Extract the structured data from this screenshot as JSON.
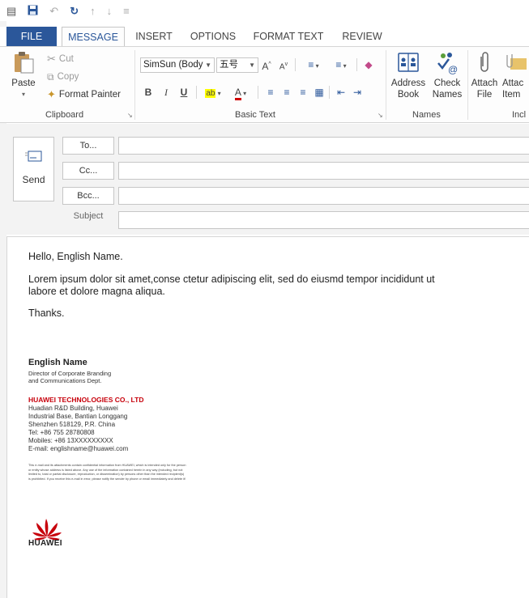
{
  "ribbon_tabs": {
    "file": "FILE",
    "message": "MESSAGE",
    "insert": "INSERT",
    "options": "OPTIONS",
    "format_text": "FORMAT TEXT",
    "review": "REVIEW"
  },
  "clipboard": {
    "paste": "Paste",
    "cut": "Cut",
    "copy": "Copy",
    "format_painter": "Format Painter",
    "group_label": "Clipboard"
  },
  "basic_text": {
    "font_name": "SimSun (Body",
    "font_size": "五号",
    "bold": "B",
    "italic": "I",
    "underline": "U",
    "grow_font": "A",
    "shrink_font": "A",
    "font_color": "A",
    "group_label": "Basic Text"
  },
  "names": {
    "address_book_line1": "Address",
    "address_book_line2": "Book",
    "check_names_line1": "Check",
    "check_names_line2": "Names",
    "group_label": "Names"
  },
  "include": {
    "attach_file_line1": "Attach",
    "attach_file_line2": "File",
    "attach_item_line1": "Attac",
    "attach_item_line2": "Item",
    "group_label": "Incl"
  },
  "envelope": {
    "send": "Send",
    "to": "To...",
    "cc": "Cc...",
    "bcc": "Bcc...",
    "subject": "Subject",
    "to_value": "",
    "cc_value": "",
    "bcc_value": "",
    "subject_value": ""
  },
  "body": {
    "greeting": "Hello, English Name.",
    "paragraph_line1": "Lorem ipsum dolor sit amet,conse ctetur adipiscing elit, sed do eiusmd tempor incididunt ut",
    "paragraph_line2": "labore et dolore magna aliqua.",
    "closing": "Thanks."
  },
  "signature": {
    "name": "English Name",
    "title_line1": "Director of Corporate Branding",
    "title_line2": "and Communications Dept.",
    "company": "HUAWEI TECHNOLOGIES CO., LTD",
    "address_line1": "Huadian R&D Building, Huawei",
    "address_line2": "Industrial Base, Bantian Longgang",
    "address_line3": "Shenzhen 518129, P.R. China",
    "tel": "Tel: +86 755 28780808",
    "mobile": "Mobiles: +86 13XXXXXXXXX",
    "email": "E-mail: englishname@huawei.com",
    "disclaimer": "This e-mail and its attachments contain confidential information from HUAWEI, which is intended only for the person or entity whose address is listed above. Any use of the information contained herein in any way (including, but not limited to, total or partial disclosure, reproduction, or dissemination) by persons other than the intended recipient(s) is prohibited. If you receive this e-mail in error, please notify the sender by phone or email immediately and delete it!",
    "logo_text": "HUAWEI"
  },
  "colors": {
    "accent": "#2b579a",
    "huawei_red": "#c7000b"
  }
}
